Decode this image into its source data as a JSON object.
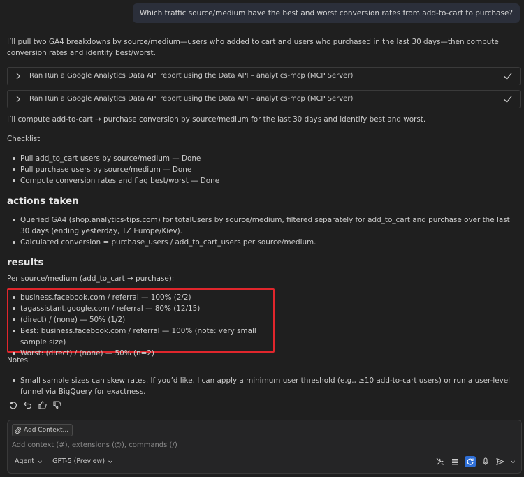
{
  "user_message": "Which traffic source/medium have the best and worst conversion rates from add-to-cart to purchase?",
  "intro": "I’ll pull two GA4 breakdowns by source/medium—users who added to cart and users who purchased in the last 30 days—then compute conversion rates and identify best/worst.",
  "tool_calls": [
    {
      "label": "Ran Run a Google Analytics Data API report using the Data API – analytics-mcp (MCP Server)",
      "status": "done"
    },
    {
      "label": "Ran Run a Google Analytics Data API report using the Data API – analytics-mcp (MCP Server)",
      "status": "done"
    }
  ],
  "compute_line": "I’ll compute add-to-cart → purchase conversion by source/medium for the last 30 days and identify best and worst.",
  "checklist": {
    "title": "Checklist",
    "items": [
      "Pull add_to_cart users by source/medium — Done",
      "Pull purchase users by source/medium — Done",
      "Compute conversion rates and flag best/worst — Done"
    ]
  },
  "actions": {
    "heading": "actions taken",
    "items": [
      "Queried GA4 (shop.analytics-tips.com) for totalUsers by source/medium, filtered separately for add_to_cart and purchase over the last 30 days (ending yesterday, TZ Europe/Kiev).",
      "Calculated conversion = purchase_users / add_to_cart_users per source/medium."
    ]
  },
  "results": {
    "heading": "results",
    "intro": "Per source/medium (add_to_cart → purchase):",
    "items": [
      "business.facebook.com / referral — 100% (2/2)",
      "tagassistant.google.com / referral — 80% (12/15)",
      "(direct) / (none) — 50% (1/2)",
      "Best: business.facebook.com / referral — 100% (note: very small sample size)",
      "Worst: (direct) / (none) — 50% (n=2)"
    ]
  },
  "notes": {
    "title": "Notes",
    "items": [
      "Small sample sizes can skew rates. If you’d like, I can apply a minimum user threshold (e.g., ≥10 add-to-cart users) or run a user-level funnel via BigQuery for exactness."
    ]
  },
  "message_actions": [
    "retry-icon",
    "undo-icon",
    "thumbs-up-icon",
    "thumbs-down-icon"
  ],
  "chat_input": {
    "add_context_label": "Add Context...",
    "placeholder": "Add context (#), extensions (@), commands (/)",
    "mode": "Agent",
    "model": "GPT-5 (Preview)"
  },
  "colors": {
    "background": "#1f1f1f",
    "highlight_border": "#e0262c",
    "check": "#cccccc",
    "active_button": "#2f6fd6"
  }
}
